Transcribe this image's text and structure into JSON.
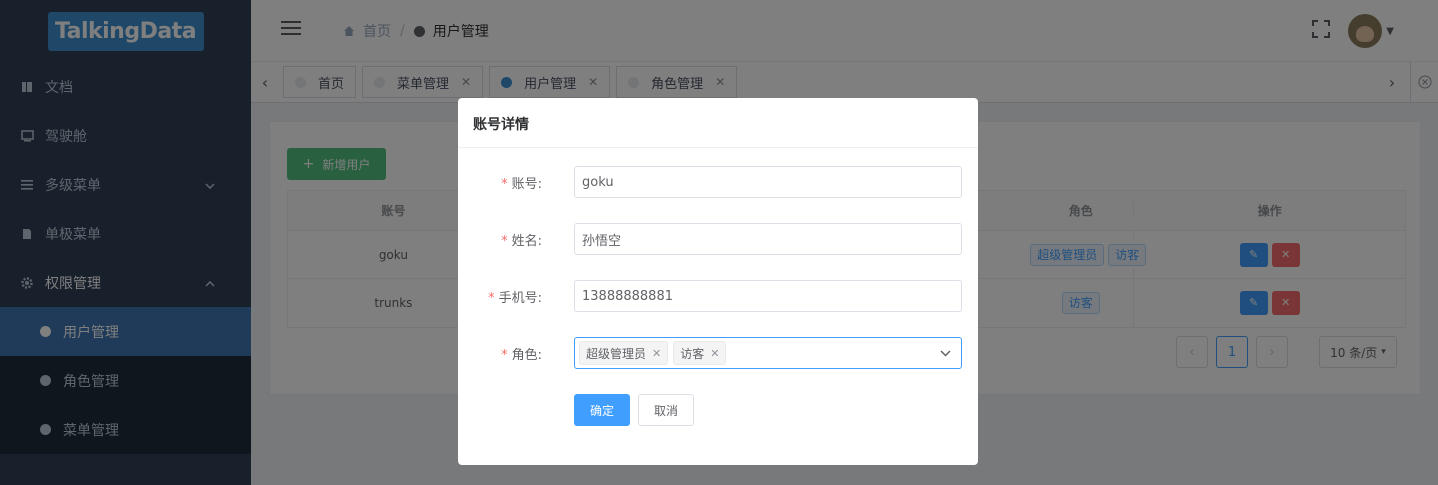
{
  "logo": "TalkingData",
  "sidebar": {
    "items": [
      {
        "label": "文档",
        "icon": "book-icon"
      },
      {
        "label": "驾驶舱",
        "icon": "monitor-icon"
      },
      {
        "label": "多级菜单",
        "icon": "list-icon"
      },
      {
        "label": "单极菜单",
        "icon": "document-icon"
      },
      {
        "label": "权限管理",
        "icon": "gear-icon"
      }
    ],
    "sub": [
      {
        "label": "用户管理"
      },
      {
        "label": "角色管理"
      },
      {
        "label": "菜单管理"
      }
    ]
  },
  "breadcrumb": {
    "home": "首页",
    "current": "用户管理"
  },
  "tags": [
    {
      "label": "首页"
    },
    {
      "label": "菜单管理"
    },
    {
      "label": "用户管理"
    },
    {
      "label": "角色管理"
    }
  ],
  "page": {
    "add_button": "新增用户",
    "table": {
      "headers": [
        "账号",
        "",
        "角色",
        "操作"
      ],
      "rows": [
        {
          "account": "goku",
          "roles": [
            "超级管理员",
            "访客"
          ]
        },
        {
          "account": "trunks",
          "roles": [
            "访客"
          ]
        }
      ]
    },
    "pager": {
      "current": "1",
      "size": "10 条/页"
    }
  },
  "dialog": {
    "title": "账号详情",
    "fields": {
      "account_label": "账号:",
      "account_value": "goku",
      "name_label": "姓名:",
      "name_value": "孙悟空",
      "phone_label": "手机号:",
      "phone_value": "13888888881",
      "role_label": "角色:",
      "roles": [
        "超级管理员",
        "访客"
      ]
    },
    "ok": "确定",
    "cancel": "取消"
  },
  "colors": {
    "primary": "#409eff",
    "sidebar": "#304156",
    "success": "#52c17e",
    "danger": "#f56c6c"
  }
}
